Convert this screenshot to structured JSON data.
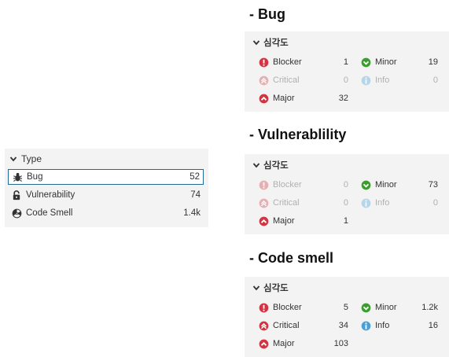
{
  "type_facet": {
    "title": "Type",
    "items": [
      {
        "label": "Bug",
        "count": "52",
        "icon": "bug-icon",
        "selected": true
      },
      {
        "label": "Vulnerability",
        "count": "74",
        "icon": "lock-icon",
        "selected": false
      },
      {
        "label": "Code Smell",
        "count": "1.4k",
        "icon": "radiation-icon",
        "selected": false
      }
    ]
  },
  "sections": [
    {
      "heading": "- Bug",
      "facet_title": "심각도",
      "blocker": {
        "label": "Blocker",
        "count": "1"
      },
      "minor": {
        "label": "Minor",
        "count": "19"
      },
      "critical": {
        "label": "Critical",
        "count": "0"
      },
      "info": {
        "label": "Info",
        "count": "0"
      },
      "major": {
        "label": "Major",
        "count": "32"
      }
    },
    {
      "heading": "- Vulnerablility",
      "facet_title": "심각도",
      "blocker": {
        "label": "Blocker",
        "count": "0"
      },
      "minor": {
        "label": "Minor",
        "count": "73"
      },
      "critical": {
        "label": "Critical",
        "count": "0"
      },
      "info": {
        "label": "Info",
        "count": "0"
      },
      "major": {
        "label": "Major",
        "count": "1"
      }
    },
    {
      "heading": "- Code smell",
      "facet_title": "심각도",
      "blocker": {
        "label": "Blocker",
        "count": "5"
      },
      "minor": {
        "label": "Minor",
        "count": "1.2k"
      },
      "critical": {
        "label": "Critical",
        "count": "34"
      },
      "info": {
        "label": "Info",
        "count": "16"
      },
      "major": {
        "label": "Major",
        "count": "103"
      }
    }
  ],
  "colors": {
    "blocker": "#d4333f",
    "critical": "#d4333f",
    "major": "#d4333f",
    "minor": "#3d9c2f",
    "info": "#4b9fd5",
    "selected_border": "#236a97",
    "panel_bg": "#f3f3f3"
  }
}
